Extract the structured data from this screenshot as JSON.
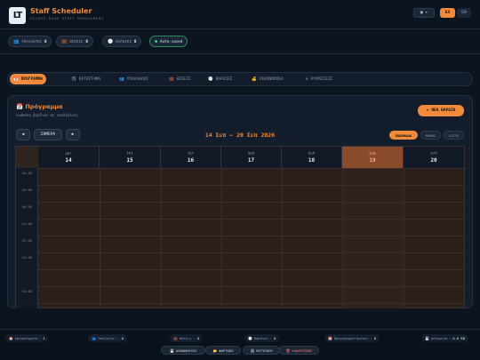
{
  "app": {
    "logo": "LT",
    "title": "Staff Scheduler",
    "subtitle": "ESCAPE ROOM STAFF MANAGEMENT",
    "theme_icon": "▦ ▾",
    "languages": [
      "ΕΛ",
      "EN"
    ],
    "active_language": "ΕΛ"
  },
  "stats": [
    {
      "icon": "👥",
      "label": "ΥΠΑΛΛΗΛΟΙ",
      "count": "0",
      "icon_name": "people-icon"
    },
    {
      "icon": "💼",
      "label": "ΘΕΣΕΙΣ",
      "count": "0",
      "icon_name": "briefcase-icon"
    },
    {
      "icon": "🕘",
      "label": "ΒΑΡΔΙΕΣ",
      "count": "0",
      "icon_name": "clock-icon"
    },
    {
      "icon": "●",
      "label": "Auto-saved",
      "count": "",
      "icon_name": "status-dot-icon"
    }
  ],
  "tabs": [
    {
      "icon": "📅",
      "label": "ΠΡΟΓΡΑΜΜΑ",
      "active": true,
      "icon_name": "calendar-icon"
    },
    {
      "icon": "🗒",
      "label": "ΚΑΤΑΣΤΗΜΑ",
      "active": false,
      "icon_name": "notepad-icon"
    },
    {
      "icon": "👥",
      "label": "ΥΠΑΛΛΗΛΟΙ",
      "active": false,
      "icon_name": "people-icon"
    },
    {
      "icon": "💼",
      "label": "ΘΕΣΕΙΣ",
      "active": false,
      "icon_name": "briefcase-icon"
    },
    {
      "icon": "🕘",
      "label": "ΒΑΡΔΙΕΣ",
      "active": false,
      "icon_name": "clock-icon"
    },
    {
      "icon": "💰",
      "label": "ΟΙΚΟΝΟΜΙΚΑ",
      "active": false,
      "icon_name": "money-bag-icon"
    },
    {
      "icon": "⚙",
      "label": "ΡΥΘΜΙΣΕΙΣ",
      "active": false,
      "icon_name": "gear-icon"
    }
  ],
  "schedule": {
    "title": "Πρόγραμμα",
    "title_icon": "📅",
    "subtitle": "Ανάθεση βαρδιών σε υπαλλήλους",
    "new_shift_label": "ΝΕΑ ΒΑΡΔΙΑ",
    "prev_label": "◀",
    "today_label": "ΣΗΜΕΡΑ",
    "next_label": "▶",
    "week_range": "14 Σεπ — 20 Σεπ 2026",
    "view_modes": [
      "ΕΒΔΟΜΑΔΑ",
      "ΜΗΝΑΣ",
      "ΛΙΣΤΑ"
    ],
    "active_view": "ΕΒΔΟΜΑΔΑ",
    "days": [
      {
        "name": "ΔΕΥ",
        "num": "14",
        "today": false
      },
      {
        "name": "ΤΡΙ",
        "num": "15",
        "today": false
      },
      {
        "name": "ΤΕΤ",
        "num": "16",
        "today": false
      },
      {
        "name": "ΠΕΜ",
        "num": "17",
        "today": false
      },
      {
        "name": "ΠΑΡ",
        "num": "18",
        "today": false
      },
      {
        "name": "ΣΑΒ",
        "num": "19",
        "today": true
      },
      {
        "name": "ΚΥΡ",
        "num": "20",
        "today": false
      }
    ],
    "times": [
      "00:00",
      "00:00",
      "00:00",
      "01:00",
      "02:00",
      "03:00",
      "04:00"
    ]
  },
  "footer": {
    "stats": [
      {
        "icon": "🏠",
        "label": "Καταστήματα",
        "value": "1"
      },
      {
        "icon": "👥",
        "label": "Υπάλληλοι",
        "value": "0"
      },
      {
        "icon": "💼",
        "label": "Θέσεις",
        "value": "0"
      },
      {
        "icon": "🕘",
        "label": "Βάρδιες",
        "value": "0"
      },
      {
        "icon": "📅",
        "label": "Προγραμματισμένες",
        "value": "0"
      },
      {
        "icon": "💾",
        "label": "Δεδομένα",
        "value": "0.0 KB"
      }
    ],
    "actions": [
      {
        "icon": "💾",
        "label": "ΑΠΟΘΗΚΕΥΣΗ",
        "icon_name": "save-icon"
      },
      {
        "icon": "📂",
        "label": "ΦΟΡΤΩΣΗ",
        "icon_name": "folder-icon"
      },
      {
        "icon": "🖨",
        "label": "ΕΚΤΥΠΩΣΗ",
        "icon_name": "printer-icon"
      },
      {
        "icon": "🗑",
        "label": "ΚΑΘΑΡΙΣΜΟΣ",
        "icon_name": "trash-icon"
      }
    ]
  }
}
